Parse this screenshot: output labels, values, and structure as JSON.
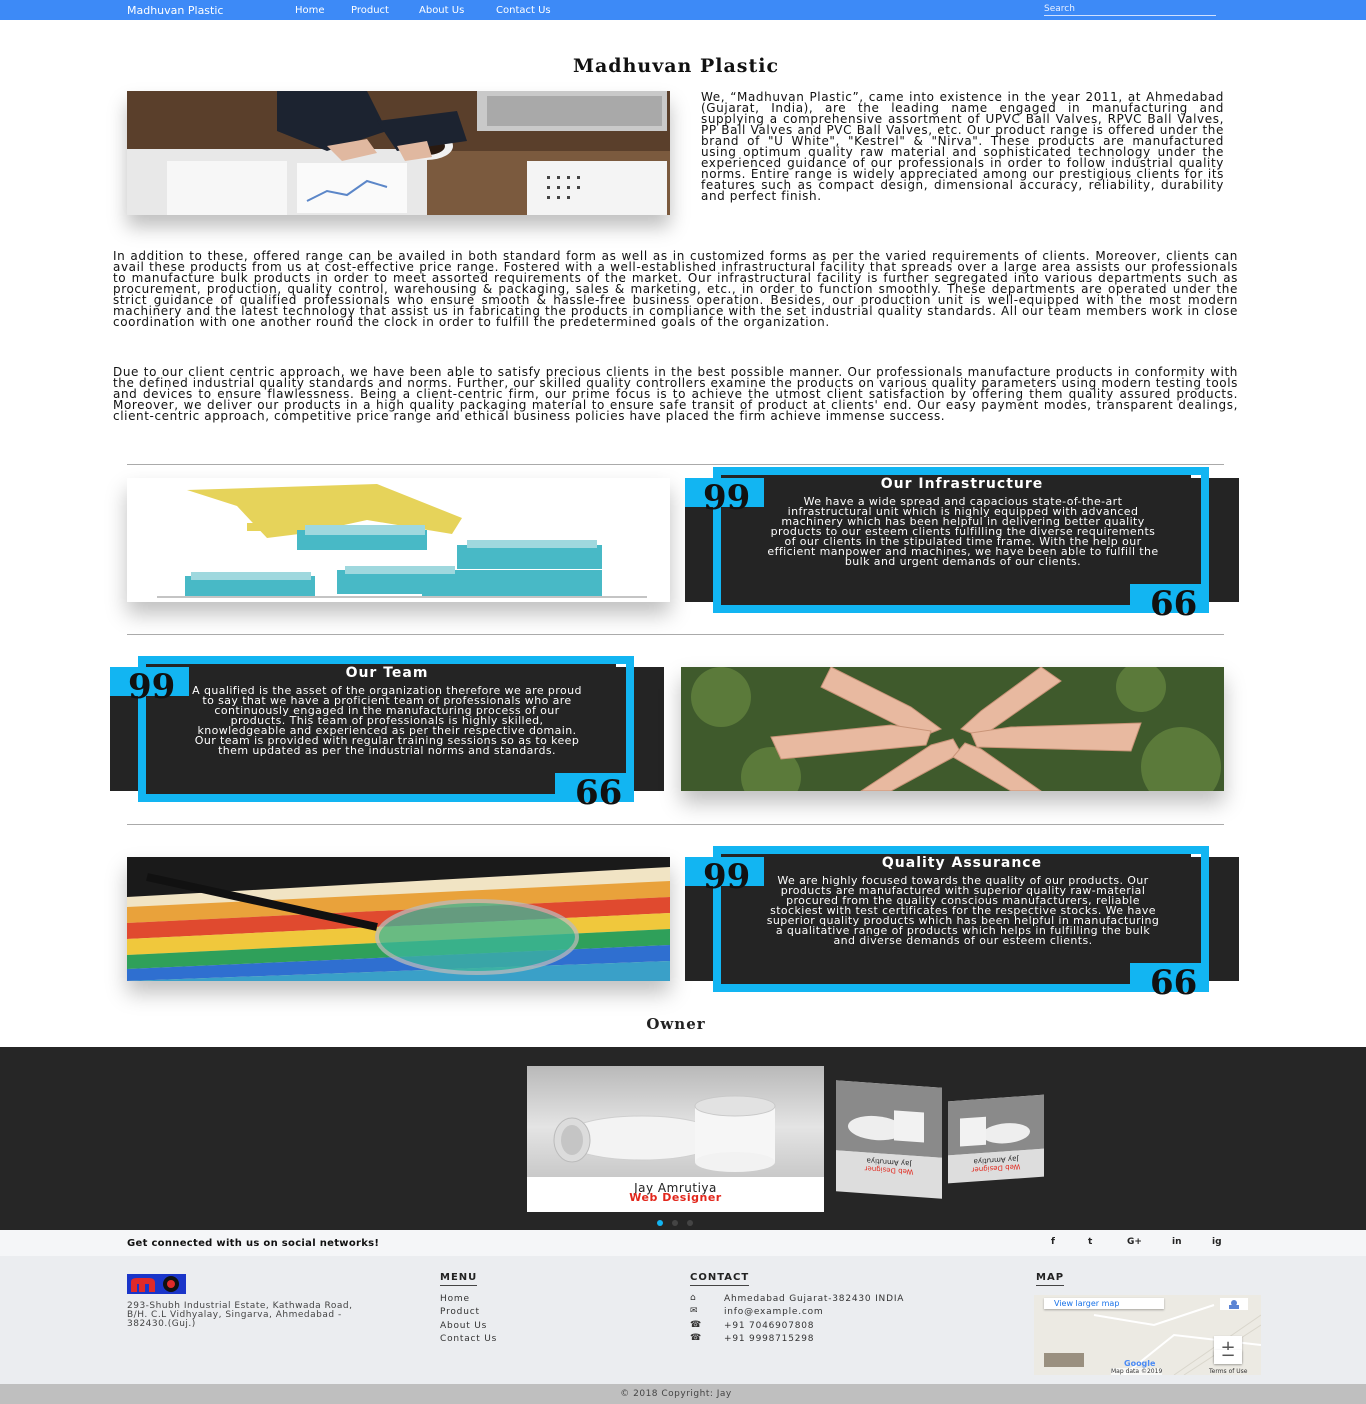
{
  "navbar": {
    "brand": "Madhuvan Plastic",
    "links": [
      "Home",
      "Product",
      "About Us",
      "Contact Us"
    ],
    "search_placeholder": "Search"
  },
  "intro": {
    "title": "Madhuvan Plastic",
    "para1": "We, “Madhuvan Plastic”, came into existence in the year 2011, at Ahmedabad (Gujarat, India), are the leading name engaged in manufacturing and supplying a comprehensive assortment of UPVC Ball Valves, RPVC Ball Valves, PP Ball Valves and PVC Ball Valves, etc. Our product range is offered under the brand of \"U White\", \"Kestrel\" & \"Nirva\". These products are manufactured using optimum quality raw material and sophisticated technology under the experienced guidance of our professionals in order to follow industrial quality norms. Entire range is widely appreciated among our prestigious clients for its features such as compact design, dimensional accuracy, reliability, durability and perfect finish.",
    "para2": "In addition to these, offered range can be availed in both standard form as well as in customized forms as per the varied requirements of clients. Moreover, clients can avail these products from us at cost-effective price range. Fostered with a well-established infrastructural facility that spreads over a large area assists our professionals to manufacture bulk products in order to meet assorted requirements of the market. Our infrastructural facility is further segregated into various departments such as procurement, production, quality control, warehousing & packaging, sales & marketing, etc., in order to function smoothly. These departments are operated under the strict guidance of qualified professionals who ensure smooth & hassle-free business operation. Besides, our production unit is well-equipped with the most modern machinery and the latest technology that assist us in fabricating the products in compliance with the set industrial quality standards. All our team members work in close coordination with one another round the clock in order to fulfill the predetermined goals of the organization.",
    "para3": "Due to our client centric approach, we have been able to satisfy precious clients in the best possible manner. Our professionals manufacture products in conformity with the defined industrial quality standards and norms. Further, our skilled quality controllers examine the products on various quality parameters using modern testing tools and devices to ensure flawlessness. Being a client-centric firm, our prime focus is to achieve the utmost client satisfaction by offering them quality assured products. Moreover, we deliver our products in a high quality packaging material to ensure safe transit of product at clients' end. Our easy payment modes, transparent dealings, client-centric approach, competitive price range and ethical business policies have placed the firm achieve immense success."
  },
  "features": [
    {
      "title": "Our Infrastructure",
      "text": "We have a wide spread and capacious state-of-the-art infrastructural unit which is highly equipped with advanced machinery which has been helpful in delivering better quality products to our esteem clients fulfilling the diverse requirements of our clients in the stipulated time frame. With the help our efficient manpower and machines, we have been able to fulfill the bulk and urgent demands of our clients."
    },
    {
      "title": "Our Team",
      "text": "A qualified is the asset of the organization therefore we are proud to say that we have a proficient team of professionals who are continuously engaged in the manufacturing process of our products. This team of professionals is highly skilled, knowledgeable and experienced as per their respective domain. Our team is provided with regular training sessions so as to keep them updated as per the industrial norms and standards."
    },
    {
      "title": "Quality Assurance",
      "text": "We are highly focused towards the quality of our products. Our products are manufactured with superior quality raw-material procured from the quality conscious manufacturers, reliable stockiest with test certificates for the respective stocks. We have superior quality products which has been helpful in manufacturing a qualitative range of products which helps in fulfilling the bulk and diverse demands of our esteem clients."
    }
  ],
  "quote_glyph": "99",
  "quote_glyph_end": "66",
  "owner": {
    "section_title": "Owner",
    "name": "Jay Amrutiya",
    "role": "Web Designer",
    "side_name": "Jay Amrutiya",
    "side_role": "Web Designer"
  },
  "social": {
    "text": "Get connected with us on social networks!",
    "icons": [
      "f",
      "t",
      "G+",
      "in",
      "ig"
    ]
  },
  "footer": {
    "address": "293-Shubh Industrial Estate, Kathwada Road, B/H. C.L Vidhyalay, Singarva, Ahmedabad - 382430.(Guj.)",
    "menu_heading": "MENU",
    "menu": [
      "Home",
      "Product",
      "About Us",
      "Contact Us"
    ],
    "contact_heading": "CONTACT",
    "contact": [
      {
        "icon": "home-icon",
        "glyph": "⌂",
        "text": "Ahmedabad Gujarat-382430 INDIA"
      },
      {
        "icon": "envelope-icon",
        "glyph": "✉",
        "text": "info@example.com"
      },
      {
        "icon": "phone-icon",
        "glyph": "☎",
        "text": "+91 7046907808"
      },
      {
        "icon": "phone-icon",
        "glyph": "☎",
        "text": "+91 9998715298"
      }
    ],
    "map_heading": "MAP",
    "map_link": "View larger map",
    "map_data": "Map data ©2019",
    "map_terms": "Terms of Use",
    "map_logo": "Google",
    "zoom_in": "+",
    "zoom_out": "−",
    "copyright": "© 2018 Copyright: Jay"
  },
  "colors": {
    "navbar": "#3d8af7",
    "accent": "#12b5f2",
    "dark_card": "#242424",
    "role_red": "#e2261b"
  }
}
